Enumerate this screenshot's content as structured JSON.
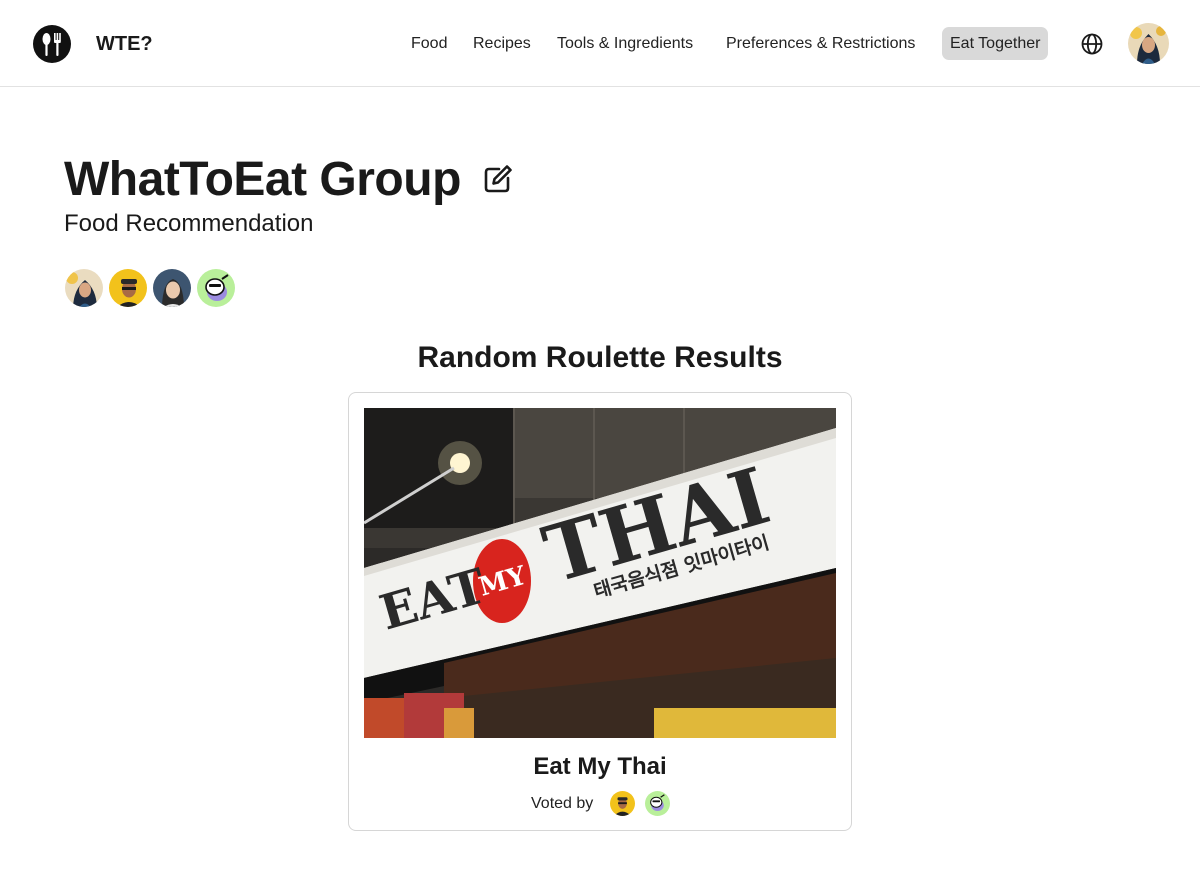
{
  "header": {
    "brand": "WTE?",
    "nav": [
      {
        "label": "Food"
      },
      {
        "label": "Recipes"
      },
      {
        "label": "Tools & Ingredients"
      },
      {
        "label": "Preferences & Restrictions"
      },
      {
        "label": "Eat Together",
        "active": true
      }
    ],
    "icons": {
      "logo": "fork-spoon-logo",
      "language": "globe-icon",
      "user": "user-avatar"
    }
  },
  "group": {
    "title": "WhatToEat Group",
    "subtitle": "Food Recommendation",
    "members": [
      "member-avatar-1",
      "member-avatar-2",
      "member-avatar-3",
      "member-avatar-4"
    ]
  },
  "results": {
    "heading": "Random Roulette Results",
    "restaurant": {
      "name": "Eat My Thai",
      "voted_by_label": "Voted by",
      "sign_text": {
        "left": "EAT",
        "circle": "MY",
        "right": "THAI",
        "korean": "태국음식점 잇마이타이"
      }
    }
  },
  "colors": {
    "accent_active_bg": "#d9d9d9",
    "sign_red": "#d8241e",
    "text": "#1a1a1a"
  }
}
